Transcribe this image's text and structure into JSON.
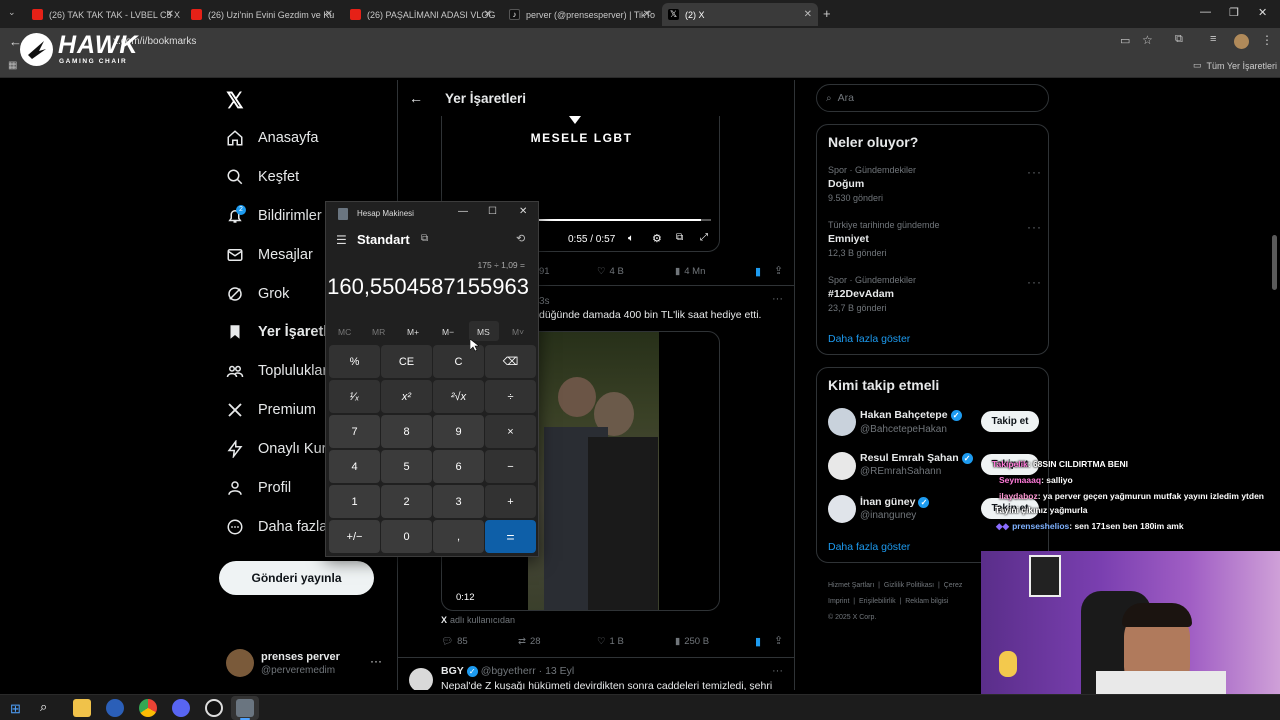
{
  "browser": {
    "tabs": [
      {
        "label": "(26) TAK TAK TAK - LVBEL C5 X",
        "icon": "youtube-icon",
        "active": false
      },
      {
        "label": "(26) Uzi'nin Evini Gezdim ve Ku",
        "icon": "youtube-icon",
        "active": false
      },
      {
        "label": "(26) PAŞALİMANI ADASI VLOG",
        "icon": "youtube-icon",
        "active": false
      },
      {
        "label": "perver (@prensesperver) | TikTo",
        "icon": "tiktok-icon",
        "active": false
      },
      {
        "label": "(2) X",
        "icon": "x-logo-icon",
        "active": true
      }
    ],
    "url": "x.com/i/bookmarks",
    "bookmarks_folder": "Tüm Yer İşaretleri",
    "overlay_logo": {
      "title": "HAWK",
      "subtitle": "GAMING CHAIR"
    }
  },
  "nav": {
    "items": [
      {
        "label": "Anasayfa",
        "icon": "home-icon"
      },
      {
        "label": "Keşfet",
        "icon": "search-icon"
      },
      {
        "label": "Bildirimler",
        "icon": "bell-icon",
        "badge": "2"
      },
      {
        "label": "Mesajlar",
        "icon": "mail-icon"
      },
      {
        "label": "Grok",
        "icon": "grok-icon"
      },
      {
        "label": "Yer İşaretleri",
        "icon": "bookmark-icon",
        "active": true
      },
      {
        "label": "Topluluklar",
        "icon": "communities-icon"
      },
      {
        "label": "Premium",
        "icon": "x-premium-icon"
      },
      {
        "label": "Onaylı Kuruluşlar",
        "icon": "bolt-icon"
      },
      {
        "label": "Profil",
        "icon": "profile-icon"
      },
      {
        "label": "Daha fazla",
        "icon": "more-icon"
      }
    ],
    "post_button": "Gönderi yayınla",
    "account": {
      "name": "prenses perver",
      "handle": "@perveremedim"
    }
  },
  "center": {
    "title": "Yer İşaretleri",
    "video1": {
      "caption": "MESELE LGBT",
      "time": "0:55 / 0:57",
      "progress": 0.96
    },
    "post1_stats": {
      "views_partial": "91",
      "likes": "4 B",
      "views": "4 Mn"
    },
    "post2": {
      "time_partial": "3s",
      "text": "düğünde damada 400 bin TL'lik saat hediye etti.",
      "video_time": "0:12",
      "reply_context": "adlı kullanıcıdan",
      "replies": "85",
      "reposts": "28",
      "likes": "1 B",
      "views": "250 B"
    },
    "post3": {
      "name": "BGY",
      "handle": "@bgyetherr",
      "date": "13 Eyl",
      "text": "Nepal'de Z kuşağı hükümeti devirdikten sonra caddeleri temizledi, şehri"
    }
  },
  "right": {
    "search_placeholder": "Ara",
    "trends_title": "Neler oluyor?",
    "trends": [
      {
        "context": "Spor · Gündemdekiler",
        "title": "Doğum",
        "count": "9.530 gönderi"
      },
      {
        "context": "Türkiye tarihinde gündemde",
        "title": "Emniyet",
        "count": "12,3 B gönderi"
      },
      {
        "context": "Spor · Gündemdekiler",
        "title": "#12DevAdam",
        "count": "23,7 B gönderi"
      }
    ],
    "trends_more": "Daha fazla göster",
    "follow_title": "Kimi takip etmeli",
    "follow": [
      {
        "name": "Hakan Bahçetepe",
        "handle": "@BahcetepeHakan",
        "button": "Takip et"
      },
      {
        "name": "Resul Emrah Şahan",
        "handle": "@REmrahSahann",
        "button": "Takip et"
      },
      {
        "name": "İnan güney",
        "handle": "@inanguney",
        "button": "Takip et"
      }
    ],
    "follow_more": "Daha fazla göster",
    "footer": [
      "Hizmet Şartları",
      "Gizlilik Politikası",
      "Çerez",
      "Imprint",
      "Erişilebilirlik",
      "Reklam bilgisi",
      "© 2025 X Corp."
    ]
  },
  "calculator": {
    "window_title": "Hesap Makinesi",
    "mode": "Standart",
    "expression": "175 ÷ 1,09 =",
    "display": "160,5504587155963",
    "memory": [
      "MC",
      "MR",
      "M+",
      "M−",
      "MS",
      "M˅"
    ],
    "keys": [
      "%",
      "CE",
      "C",
      "⌫",
      "¹⁄ₓ",
      "x²",
      "²√x",
      "÷",
      "7",
      "8",
      "9",
      "×",
      "4",
      "5",
      "6",
      "−",
      "1",
      "2",
      "3",
      "+",
      "+/−",
      "0",
      ",",
      "="
    ]
  },
  "stream_chat": [
    {
      "user": "Takipelik",
      "text": ": 68SIN CILDIRTMA BENI",
      "color": "#ff7ad9"
    },
    {
      "user": "Seymaaaq",
      "text": ": salliyo",
      "color": "#ff7ad9"
    },
    {
      "user": "ilaydaboz",
      "text": ": ya perver geçen yağmurun mutfak yayını izledim ytden",
      "color": "#ff9ad5"
    },
    {
      "user": "",
      "text": "Tayini çıkınız yağmurla",
      "color": "#ffffff"
    },
    {
      "user": "prenseshelios",
      "text": ": sen 171sen ben 180im amk",
      "color": "#7fb2ff"
    }
  ],
  "colors": {
    "accent": "#1d9bf0",
    "calc_equals": "#0e5fa8",
    "bg": "#000000",
    "border": "#2f3336"
  }
}
